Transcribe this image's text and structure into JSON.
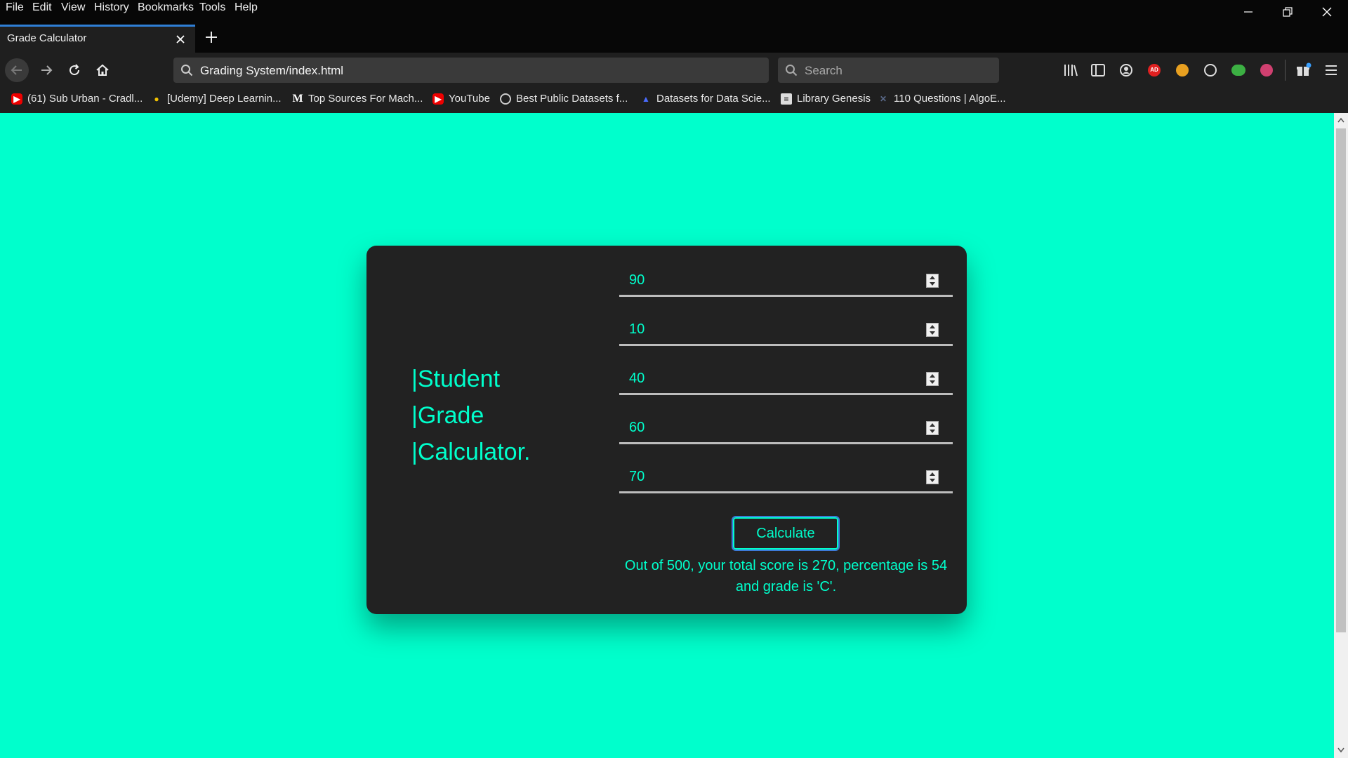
{
  "menu": [
    "File",
    "Edit",
    "View",
    "History",
    "Bookmarks",
    "Tools",
    "Help"
  ],
  "tab": {
    "title": "Grade Calculator"
  },
  "address": {
    "url": "Grading System/index.html",
    "search_placeholder": "Search"
  },
  "bookmarks": [
    {
      "label": "(61) Sub Urban - Cradl...",
      "icon": "youtube-icon"
    },
    {
      "label": "[Udemy] Deep Learnin...",
      "icon": "lightbulb-icon"
    },
    {
      "label": "Top Sources For Mach...",
      "icon": "medium-icon"
    },
    {
      "label": "YouTube",
      "icon": "youtube-icon"
    },
    {
      "label": "Best Public Datasets f...",
      "icon": "globe-icon"
    },
    {
      "label": "Datasets for Data Scie...",
      "icon": "triangle-icon"
    },
    {
      "label": "Library Genesis",
      "icon": "book-icon"
    },
    {
      "label": "110 Questions | AlgoE...",
      "icon": "algo-icon"
    }
  ],
  "calculator": {
    "heading_lines": [
      "|Student",
      "|Grade",
      "|Calculator."
    ],
    "fields": [
      "90",
      "10",
      "40",
      "60",
      "70"
    ],
    "button_label": "Calculate",
    "result_line1": "Out of 500, your total score is 270, percentage is 54",
    "result_line2": "and grade is 'C'."
  },
  "colors": {
    "accent": "#00ffcc",
    "card": "#222222",
    "focus": "#3d7ad8"
  }
}
